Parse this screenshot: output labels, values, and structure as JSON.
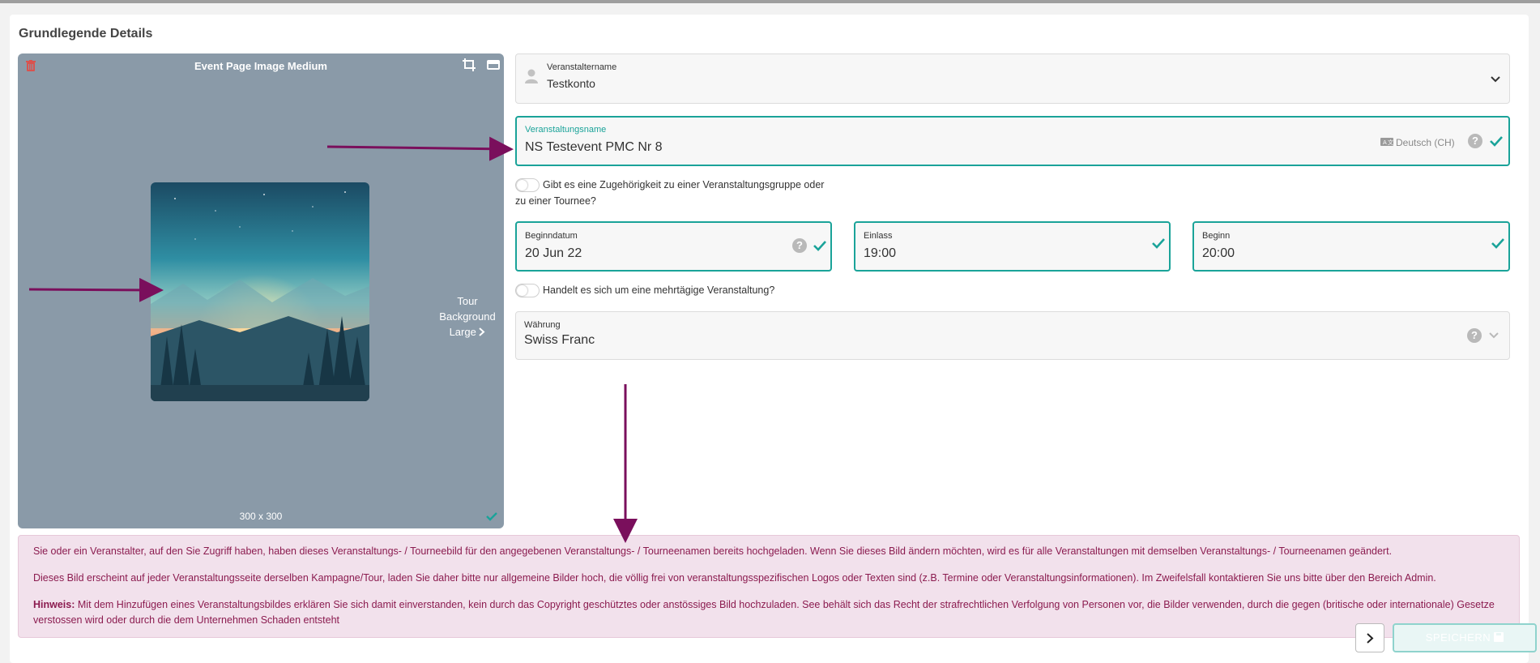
{
  "section_title": "Grundlegende Details",
  "image_panel": {
    "title": "Event Page Image Medium",
    "next_label_lines": [
      "Tour",
      "Background",
      "Large"
    ],
    "size": "300 x 300"
  },
  "organizer": {
    "label": "Veranstaltername",
    "value": "Testkonto"
  },
  "event_name": {
    "label": "Veranstaltungsname",
    "value": "NS Testevent PMC Nr 8",
    "language": "Deutsch (CH)",
    "help": "?"
  },
  "group_question": {
    "line1": "Gibt es eine Zugehörigkeit zu einer Veranstaltungsgruppe oder",
    "line2": "zu einer Tournee?"
  },
  "start_date": {
    "label": "Beginndatum",
    "value": "20 Jun 22",
    "help": "?"
  },
  "admission": {
    "label": "Einlass",
    "value": "19:00"
  },
  "begin": {
    "label": "Beginn",
    "value": "20:00"
  },
  "multi_day_question": "Handelt es sich um eine mehrtägige Veranstaltung?",
  "currency": {
    "label": "Währung",
    "value": "Swiss Franc",
    "help": "?"
  },
  "notice": {
    "p1": "Sie oder ein Veranstalter, auf den Sie Zugriff haben, haben dieses Veranstaltungs- / Tourneebild für den angegebenen Veranstaltungs- / Tourneenamen bereits hochgeladen. Wenn Sie dieses Bild ändern möchten, wird es für alle Veranstaltungen mit demselben Veranstaltungs- / Tourneenamen geändert.",
    "p2": "Dieses Bild erscheint auf jeder Veranstaltungsseite derselben Kampagne/Tour, laden Sie daher bitte nur allgemeine Bilder hoch, die völlig frei von veranstaltungsspezifischen Logos oder Texten sind (z.B. Termine oder Veranstaltungsinformationen). Im Zweifelsfall kontaktieren Sie uns bitte über den Bereich Admin.",
    "p3_bold": "Hinweis:",
    "p3": " Mit dem Hinzufügen eines Veranstaltungsbildes erklären Sie sich damit einverstanden, kein durch das Copyright geschütztes oder anstössiges Bild hochzuladen. See behält sich das Recht der strafrechtlichen Verfolgung von Personen vor, die Bilder verwenden, durch die gegen (britische oder internationale) Gesetze verstossen wird oder durch die dem Unternehmen Schaden entsteht"
  },
  "save_label": "SPEICHERN",
  "colors": {
    "accent": "#1aa399",
    "notice_bg": "#f2e1ec",
    "notice_text": "#8b1b4f",
    "panel_bg": "#8a9aa8",
    "annotation_arrow": "#7a0f5c"
  }
}
